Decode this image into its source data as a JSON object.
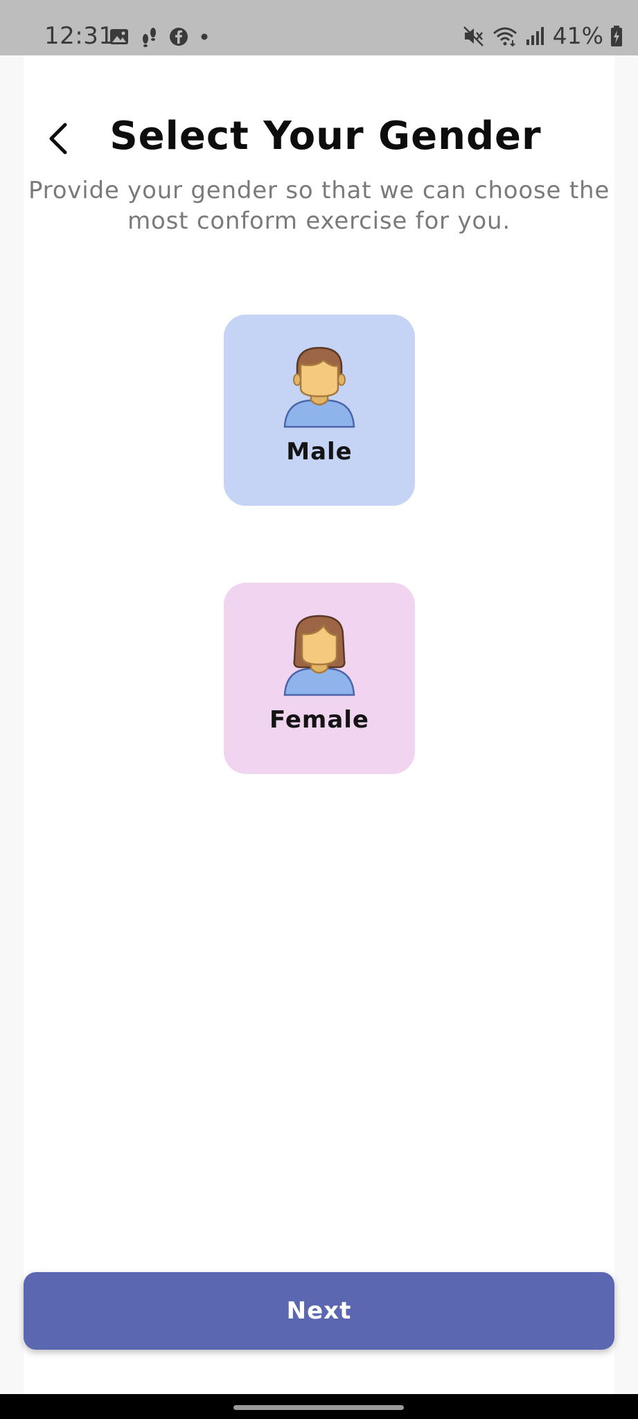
{
  "status_bar": {
    "time": "12:31",
    "battery_percent": "41%",
    "left_icons": [
      "image-icon",
      "footsteps-icon",
      "facebook-icon",
      "dot-icon"
    ],
    "right_icons": [
      "mute-icon",
      "wifi-icon",
      "signal-icon",
      "battery-icon"
    ]
  },
  "header": {
    "title": "Select Your Gender",
    "subtitle_line1": "Provide your gender so that we can choose the",
    "subtitle_line2": "most conform exercise for you."
  },
  "options": [
    {
      "label": "Male",
      "color": "#c5d3f5",
      "icon": "male-avatar-icon"
    },
    {
      "label": "Female",
      "color": "#f1d5f0",
      "icon": "female-avatar-icon"
    }
  ],
  "footer": {
    "next_label": "Next",
    "next_color": "#5c67b2"
  }
}
